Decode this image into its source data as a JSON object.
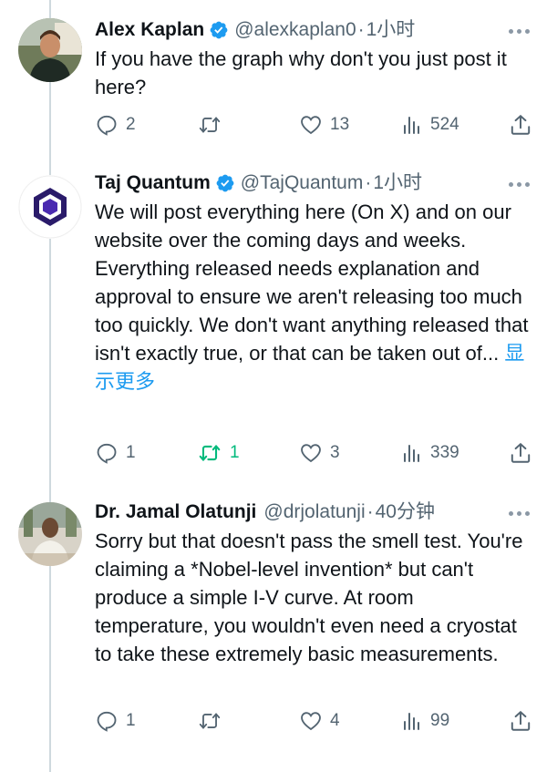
{
  "tweets": [
    {
      "name": "Alex Kaplan",
      "handle": "@alexkaplan0",
      "separator": "·",
      "time": "1小时",
      "text": "If you have the graph why don't you just post it here?",
      "show_more": "",
      "stats": {
        "replies": "2",
        "retweets": "",
        "likes": "13",
        "views": "524"
      },
      "retweeted": false,
      "avatar_icon": "person-photo-avatar"
    },
    {
      "name": "Taj Quantum",
      "handle": "@TajQuantum",
      "separator": "·",
      "time": "1小时",
      "text": "We will post everything here (On X) and on our website over the coming days and weeks. Everything released needs explanation and approval to ensure we aren't releasing too much too quickly. We don't want anything released that isn't exactly true, or that can be taken out of...",
      "show_more": "显示更多",
      "stats": {
        "replies": "1",
        "retweets": "1",
        "likes": "3",
        "views": "339"
      },
      "retweeted": true,
      "avatar_icon": "hexagon-logo-avatar"
    },
    {
      "name": "Dr. Jamal Olatunji",
      "handle": "@drjolatunji",
      "separator": "·",
      "time": "40分钟",
      "text": "Sorry but that doesn't pass the smell test. You're claiming a *Nobel-level invention* but can't produce a simple I-V curve. At room temperature, you wouldn't even need a cryostat to take these extremely basic measurements.",
      "show_more": "",
      "stats": {
        "replies": "1",
        "retweets": "",
        "likes": "4",
        "views": "99"
      },
      "retweeted": false,
      "avatar_icon": "person-photo-avatar"
    }
  ],
  "colors": {
    "link": "#1d9bf0",
    "verified": "#1d9bf0",
    "retweet_active": "#00ba7c",
    "muted": "#536471",
    "thread_line": "#cfd9de"
  }
}
